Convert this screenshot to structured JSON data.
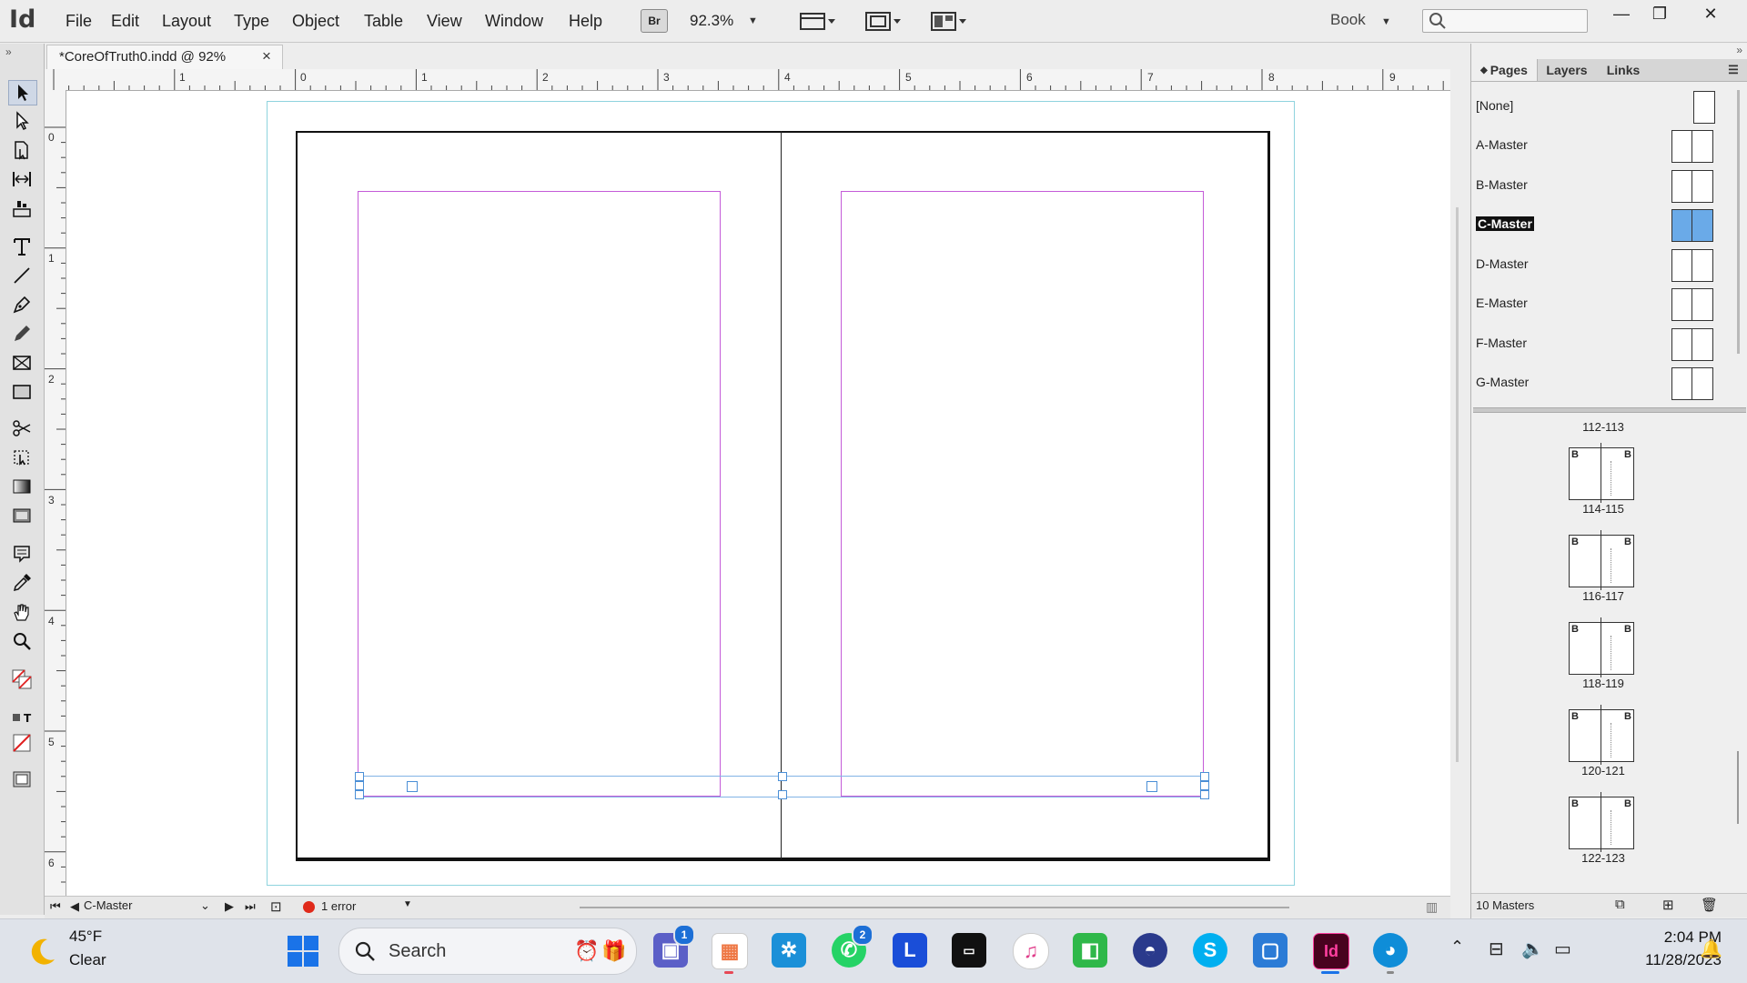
{
  "app": {
    "logo": "Id",
    "bridge_label": "Br",
    "zoom": "92.3%",
    "workspace": "Book"
  },
  "menu": [
    "File",
    "Edit",
    "Layout",
    "Type",
    "Object",
    "Table",
    "View",
    "Window",
    "Help"
  ],
  "window_controls": {
    "minimize": "—",
    "restore": "❐",
    "close": "✕"
  },
  "document": {
    "tab_title": "*CoreOfTruth0.indd @ 92%",
    "close_glyph": "×"
  },
  "ruler": {
    "horizontal": [
      "1",
      "0",
      "1",
      "2",
      "3",
      "4",
      "5",
      "6",
      "7",
      "8",
      "9"
    ],
    "vertical": [
      "0",
      "1",
      "2",
      "3",
      "4",
      "5",
      "6"
    ]
  },
  "status": {
    "current_page": "C-Master",
    "preflight": "1 error"
  },
  "panel": {
    "tabs": [
      "Pages",
      "Layers",
      "Links"
    ],
    "masters": [
      {
        "label": "[None]",
        "selected": false
      },
      {
        "label": "A-Master",
        "selected": false
      },
      {
        "label": "B-Master",
        "selected": false
      },
      {
        "label": "C-Master",
        "selected": true
      },
      {
        "label": "D-Master",
        "selected": false
      },
      {
        "label": "E-Master",
        "selected": false
      },
      {
        "label": "F-Master",
        "selected": false
      },
      {
        "label": "G-Master",
        "selected": false
      }
    ],
    "first_spread_label": "112-113",
    "spreads": [
      {
        "label": "114-115",
        "master": "B"
      },
      {
        "label": "116-117",
        "master": "B"
      },
      {
        "label": "118-119",
        "master": "B"
      },
      {
        "label": "120-121",
        "master": "B"
      },
      {
        "label": "122-123",
        "master": "B"
      }
    ],
    "footer": "10 Masters"
  },
  "taskbar": {
    "weather_temp": "45°F",
    "weather_desc": "Clear",
    "search_label": "Search",
    "time": "2:04 PM",
    "date": "11/28/2023",
    "badges": {
      "teams": "1",
      "whatsapp": "2"
    },
    "icon_letters": {
      "l_app": "L",
      "skype": "S",
      "indesign": "Id"
    }
  },
  "colors": {
    "margin_guide": "#c45bd8",
    "selection": "#4b8fd6",
    "pasteboard_frame": "#8fd3de",
    "master_selected": "#6aaae8"
  }
}
